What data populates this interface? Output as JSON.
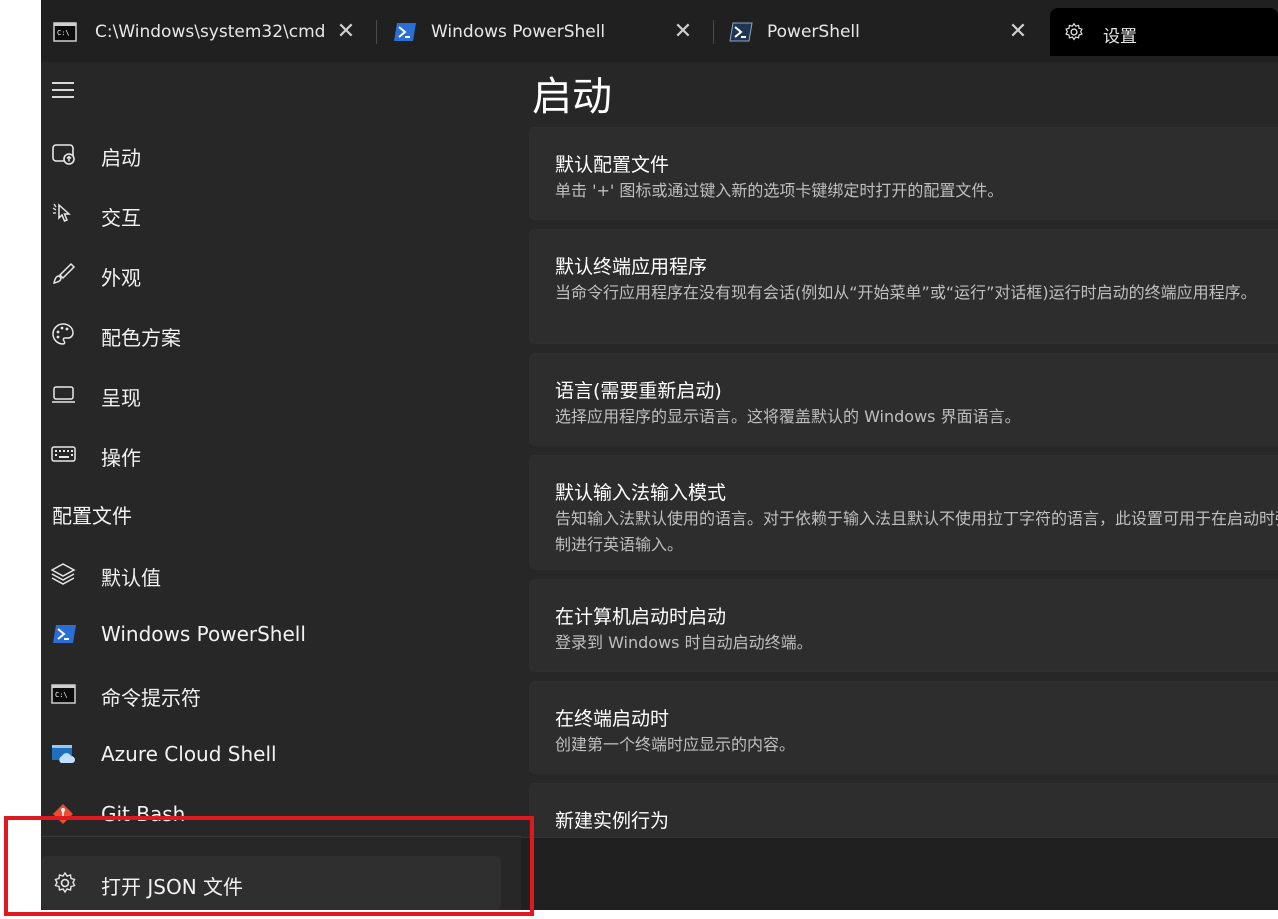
{
  "tabs": [
    {
      "label": "C:\\Windows\\system32\\cmd",
      "icon": "cmd-icon"
    },
    {
      "label": "Windows PowerShell",
      "icon": "powershell-icon"
    },
    {
      "label": "PowerShell",
      "icon": "powershell-core-icon"
    },
    {
      "label": "设置",
      "icon": "gear-icon"
    }
  ],
  "close_glyph": "✕",
  "sidebar": {
    "items": [
      {
        "label": "启动",
        "icon": "startup-icon"
      },
      {
        "label": "交互",
        "icon": "cursor-icon"
      },
      {
        "label": "外观",
        "icon": "brush-icon"
      },
      {
        "label": "配色方案",
        "icon": "palette-icon"
      },
      {
        "label": "呈现",
        "icon": "laptop-icon"
      },
      {
        "label": "操作",
        "icon": "keyboard-icon"
      }
    ],
    "section_header": "配置文件",
    "profiles": [
      {
        "label": "默认值",
        "icon": "layers-icon"
      },
      {
        "label": "Windows PowerShell",
        "icon": "powershell-icon"
      },
      {
        "label": "命令提示符",
        "icon": "cmd-icon"
      },
      {
        "label": "Azure Cloud Shell",
        "icon": "azure-icon"
      },
      {
        "label": "Git Bash",
        "icon": "git-icon"
      }
    ],
    "open_json": {
      "label": "打开 JSON 文件",
      "icon": "gear-icon"
    }
  },
  "main": {
    "title": "启动",
    "cards": [
      {
        "title": "默认配置文件",
        "desc": "单击 '+' 图标或通过键入新的选项卡键绑定时打开的配置文件。"
      },
      {
        "title": "默认终端应用程序",
        "desc": "当命令行应用程序在没有现有会话(例如从“开始菜单”或“运行”对话框)运行时启动的终端应用程序。"
      },
      {
        "title": "语言(需要重新启动)",
        "desc": "选择应用程序的显示语言。这将覆盖默认的 Windows 界面语言。"
      },
      {
        "title": "默认输入法输入模式",
        "desc": "告知输入法默认使用的语言。对于依赖于输入法且默认不使用拉丁字符的语言，此设置可用于在启动时强制进行英语输入。"
      },
      {
        "title": "在计算机启动时启动",
        "desc": "登录到 Windows 时自动启动终端。"
      },
      {
        "title": "在终端启动时",
        "desc": "创建第一个终端时应显示的内容。"
      },
      {
        "title": "新建实例行为",
        "desc": ""
      }
    ]
  },
  "colors": {
    "highlight": "#e0191e",
    "accent_blue": "#2b6fd6"
  }
}
